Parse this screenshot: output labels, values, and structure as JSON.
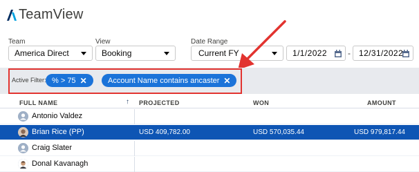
{
  "app": {
    "title": "TeamView",
    "accent": "#032d60"
  },
  "filters": {
    "team_label": "Team",
    "team_value": "America Direct",
    "view_label": "View",
    "view_value": "Booking",
    "date_label": "Date Range",
    "date_value": "Current FY",
    "start_date": "1/1/2022",
    "end_date": "12/31/2022",
    "dash": "-"
  },
  "active_filters": {
    "label": "Active Filter:",
    "pills": [
      {
        "text": "% > 75",
        "close": "✕"
      },
      {
        "text": "Account Name contains ancaster",
        "close": "✕"
      }
    ],
    "pill_color": "#1b73d9",
    "highlight_color": "#e2332f"
  },
  "table": {
    "columns": [
      "FULL NAME",
      "PROJECTED",
      "WON",
      "AMOUNT"
    ],
    "sort_indicator": "↑",
    "rows": [
      {
        "name": "Antonio Valdez",
        "projected": "",
        "won": "",
        "amount": ""
      },
      {
        "name": "Brian Rice (PP)",
        "projected": "USD 409,782.00",
        "won": "USD 570,035.44",
        "amount": "USD 979,817.44"
      },
      {
        "name": "Craig Slater",
        "projected": "",
        "won": "",
        "amount": ""
      },
      {
        "name": "Donal Kavanagh",
        "projected": "",
        "won": "",
        "amount": ""
      }
    ],
    "selected_color": "#0e55b4"
  }
}
